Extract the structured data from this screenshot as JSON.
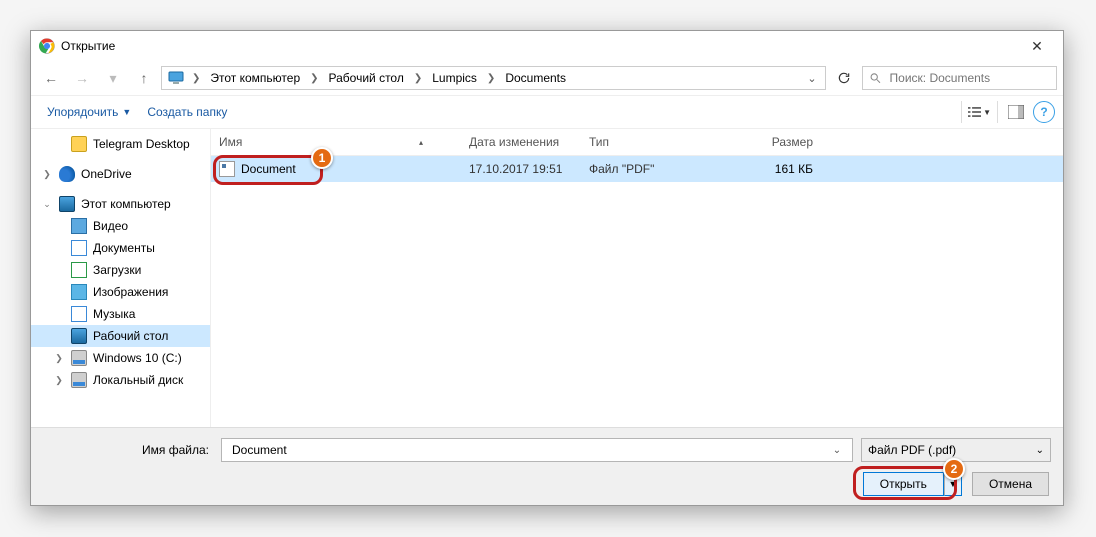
{
  "window": {
    "title": "Открытие"
  },
  "nav": {
    "breadcrumb": [
      "Этот компьютер",
      "Рабочий стол",
      "Lumpics",
      "Documents"
    ]
  },
  "search": {
    "placeholder": "Поиск: Documents"
  },
  "toolbar": {
    "organize": "Упорядочить",
    "new_folder": "Создать папку"
  },
  "sidebar": {
    "items": [
      {
        "label": "Telegram Desktop",
        "icon": "folder"
      },
      {
        "label": "OneDrive",
        "icon": "onedrive",
        "chevron": true
      },
      {
        "label": "Этот компьютер",
        "icon": "monitor",
        "chevron": true,
        "expanded": true
      },
      {
        "label": "Видео",
        "icon": "film"
      },
      {
        "label": "Документы",
        "icon": "note"
      },
      {
        "label": "Загрузки",
        "icon": "down"
      },
      {
        "label": "Изображения",
        "icon": "pic"
      },
      {
        "label": "Музыка",
        "icon": "mus"
      },
      {
        "label": "Рабочий стол",
        "icon": "monitor",
        "selected": true
      },
      {
        "label": "Windows 10 (C:)",
        "icon": "disk"
      },
      {
        "label": "Локальный диск",
        "icon": "disk"
      }
    ]
  },
  "list": {
    "columns": {
      "name": "Имя",
      "date": "Дата изменения",
      "type": "Тип",
      "size": "Размер"
    },
    "rows": [
      {
        "name": "Document",
        "date": "17.10.2017 19:51",
        "type": "Файл \"PDF\"",
        "size": "161 КБ"
      }
    ]
  },
  "footer": {
    "filename_label": "Имя файла:",
    "filename_value": "Document",
    "filter_label": "Файл PDF (.pdf)",
    "open": "Открыть",
    "cancel": "Отмена"
  },
  "callouts": {
    "one": "1",
    "two": "2"
  }
}
